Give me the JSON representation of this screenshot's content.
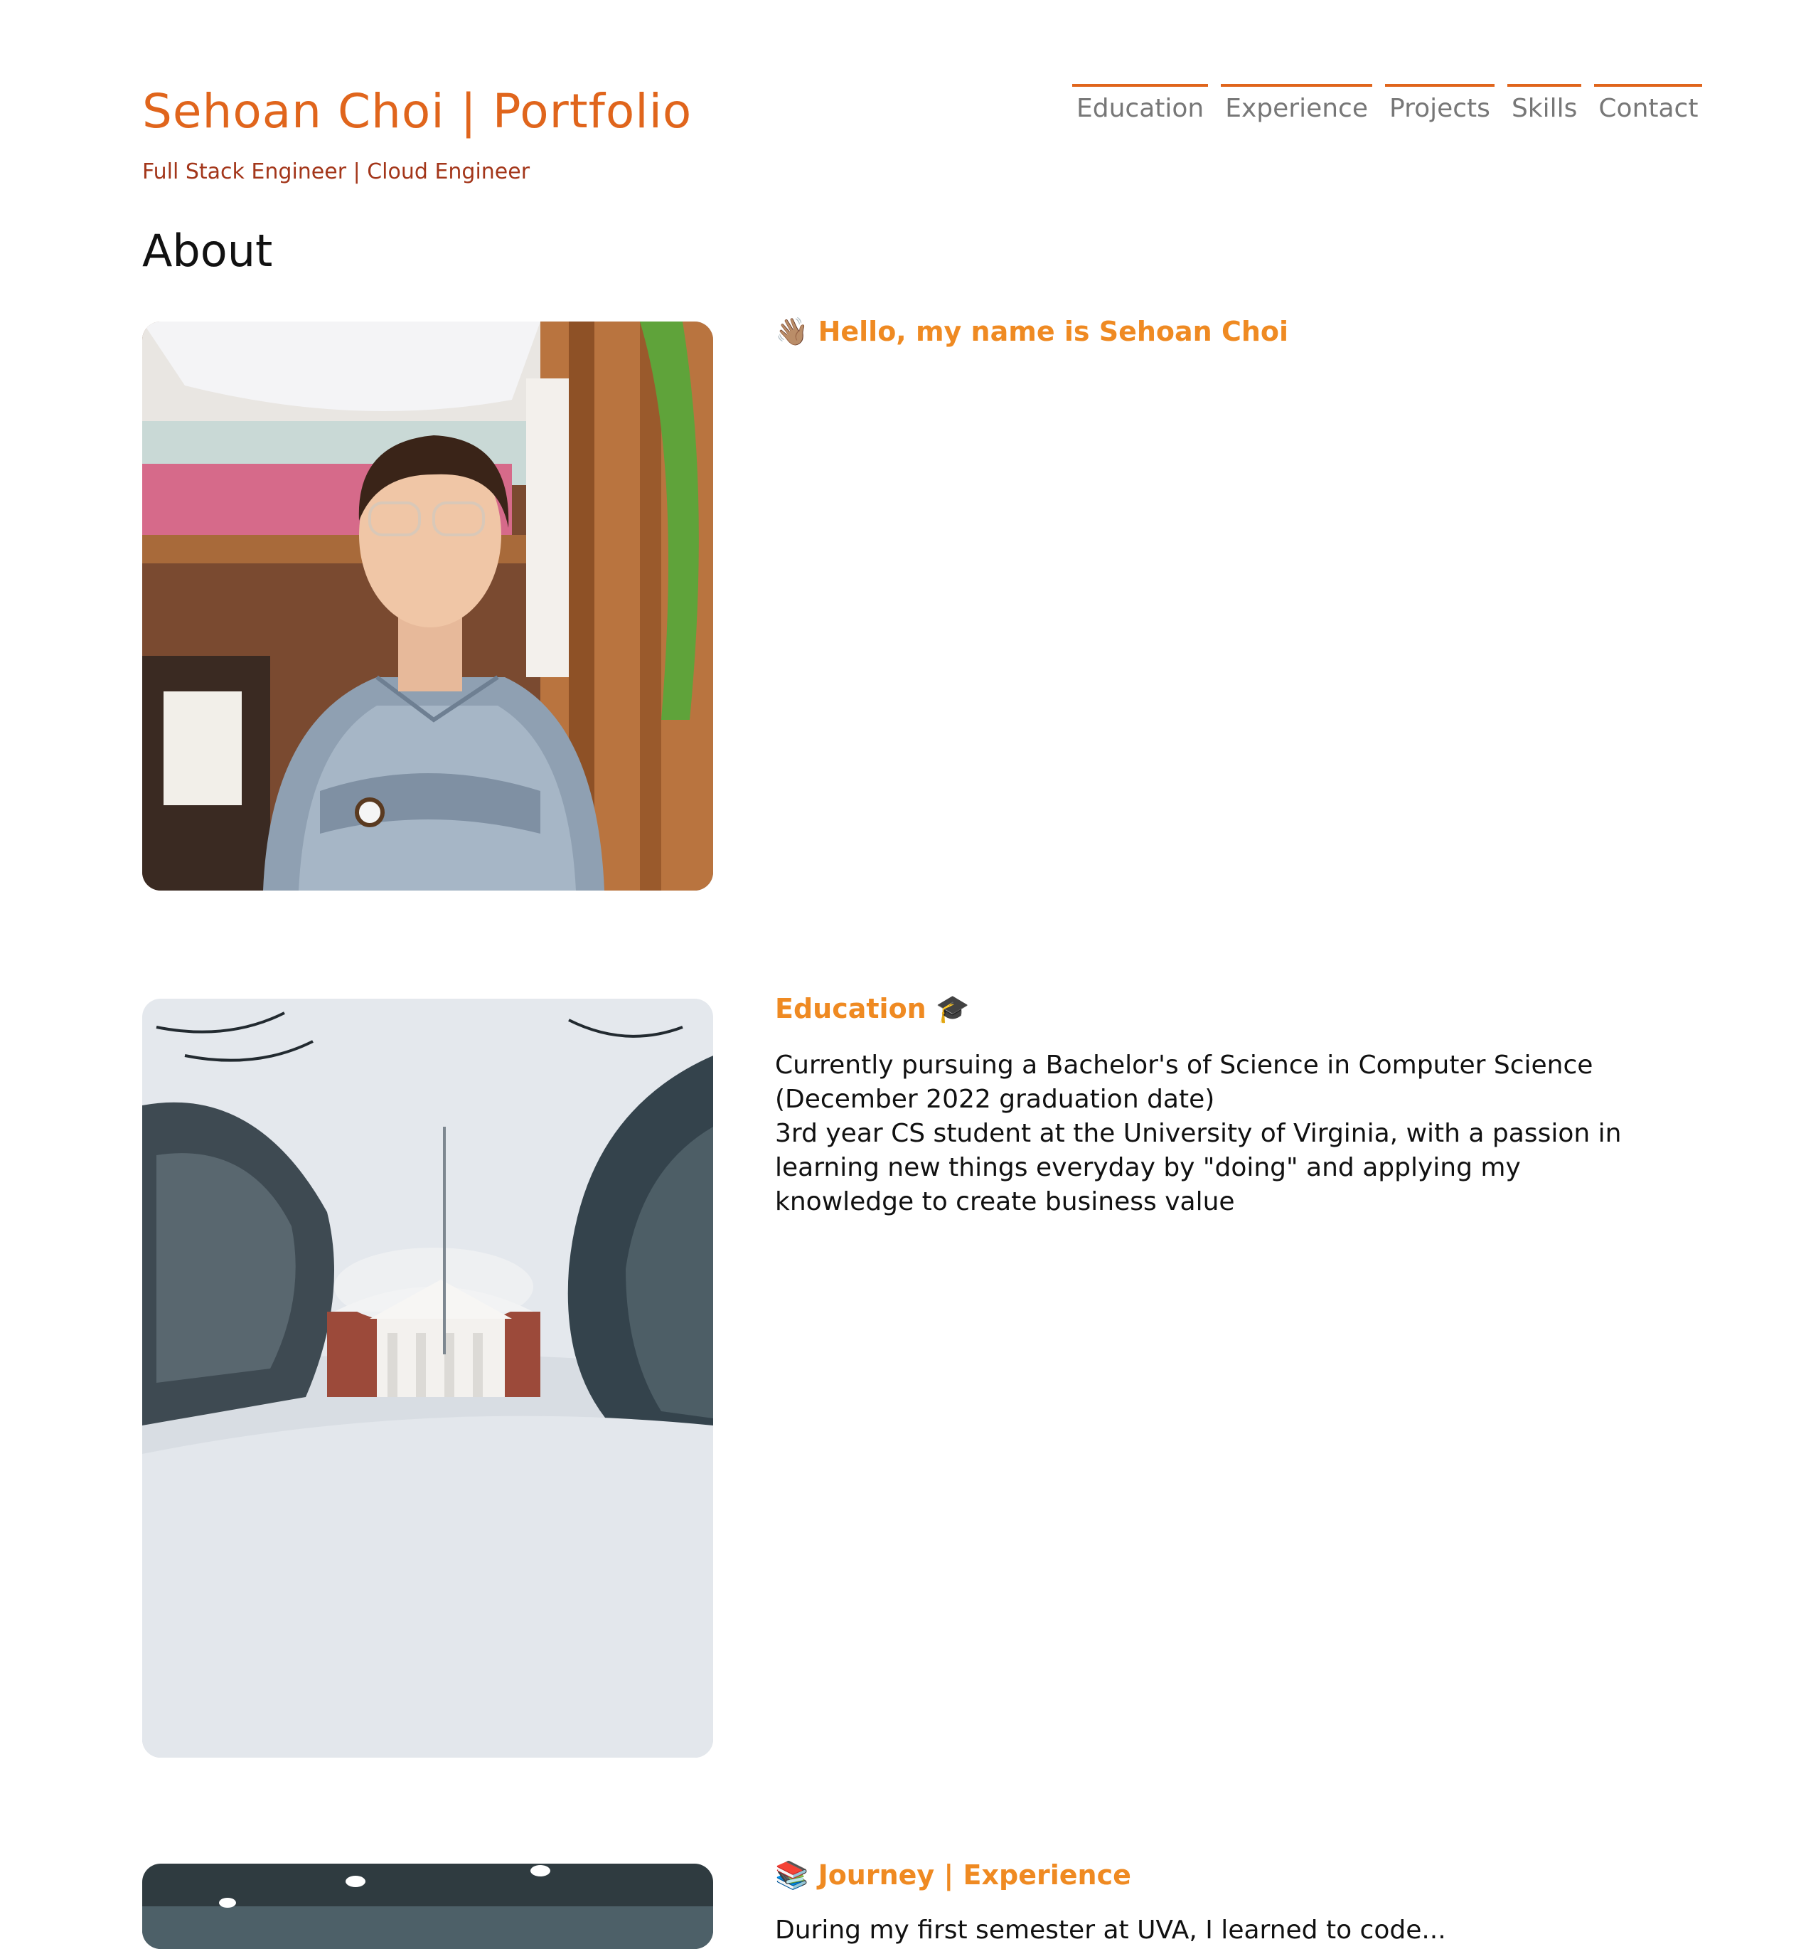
{
  "header": {
    "title": "Sehoan Choi | Portfolio",
    "subtitle": "Full Stack Engineer | Cloud Engineer"
  },
  "nav": {
    "items": [
      {
        "label": "Education"
      },
      {
        "label": "Experience"
      },
      {
        "label": "Projects"
      },
      {
        "label": "Skills"
      },
      {
        "label": "Contact"
      }
    ]
  },
  "about": {
    "title": "About",
    "cards": [
      {
        "emoji_before": "👋🏽",
        "heading": "Hello, my name is Sehoan Choi",
        "emoji_after": "",
        "image_icon": "portrait-photo"
      },
      {
        "emoji_before": "",
        "heading": "Education",
        "emoji_after": "🎓",
        "paragraphs": [
          "Currently pursuing a Bachelor's of Science in Computer Science (December 2022 graduation date)",
          "3rd year CS student at the University of Virginia, with a passion in learning new things everyday by \"doing\" and applying my knowledge to create business value"
        ],
        "image_icon": "snowy-rotunda-photo"
      },
      {
        "emoji_before": "📚",
        "heading": "Journey | Experience",
        "emoji_after": "",
        "paragraphs": [
          "During my first semester at UVA, I learned to code..."
        ],
        "image_icon": "office-photo"
      }
    ]
  },
  "colors": {
    "title": "#e0651c",
    "subtitle": "#a3361a",
    "heading": "#ef8a22",
    "nav_text": "#777777",
    "nav_rule": "#e0651c"
  }
}
